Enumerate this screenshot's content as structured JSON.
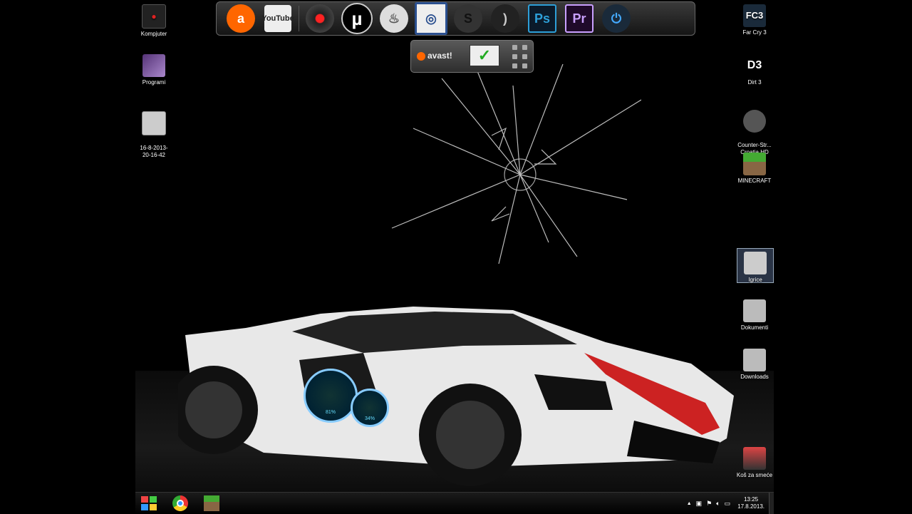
{
  "desktop_icons_left": [
    {
      "label": "Kompjuter"
    },
    {
      "label": "Programi"
    },
    {
      "label": "16-8-2013-\n20-16-42"
    }
  ],
  "desktop_icons_right": [
    {
      "label": "Far Cry 3",
      "badge": "FC3"
    },
    {
      "label": "Dirt 3",
      "badge": "D3"
    },
    {
      "label": "Counter-Str...\nCroatia HD"
    },
    {
      "label": "MINECRAFT"
    },
    {
      "label": "Igrice"
    },
    {
      "label": "Dokumenti"
    },
    {
      "label": "Downloads"
    },
    {
      "label": "Koš za smeće"
    }
  ],
  "dock": {
    "items": [
      {
        "name": "avast",
        "text": ""
      },
      {
        "name": "youtube",
        "text": "YouTube"
      },
      {
        "name": "hal",
        "text": ""
      },
      {
        "name": "utorrent",
        "text": "µ"
      },
      {
        "name": "burn",
        "text": ""
      },
      {
        "name": "steam",
        "text": ""
      },
      {
        "name": "skype",
        "text": ""
      },
      {
        "name": "origin",
        "text": ""
      },
      {
        "name": "photoshop",
        "text": "Ps"
      },
      {
        "name": "premiere",
        "text": "Pr"
      },
      {
        "name": "shutdown",
        "text": ""
      }
    ]
  },
  "gadget": {
    "brand": "avast!",
    "check": "✓"
  },
  "speed_gadget": {
    "big": "81%",
    "small": "34%"
  },
  "taskbar": {
    "clock_time": "13:25",
    "clock_date": "17.8.2013.",
    "tray_arrow": "▲"
  },
  "colors": {
    "accent_orange": "#ff6600",
    "ps_blue": "#2d9fd8",
    "pr_purple": "#c9a0ff"
  }
}
